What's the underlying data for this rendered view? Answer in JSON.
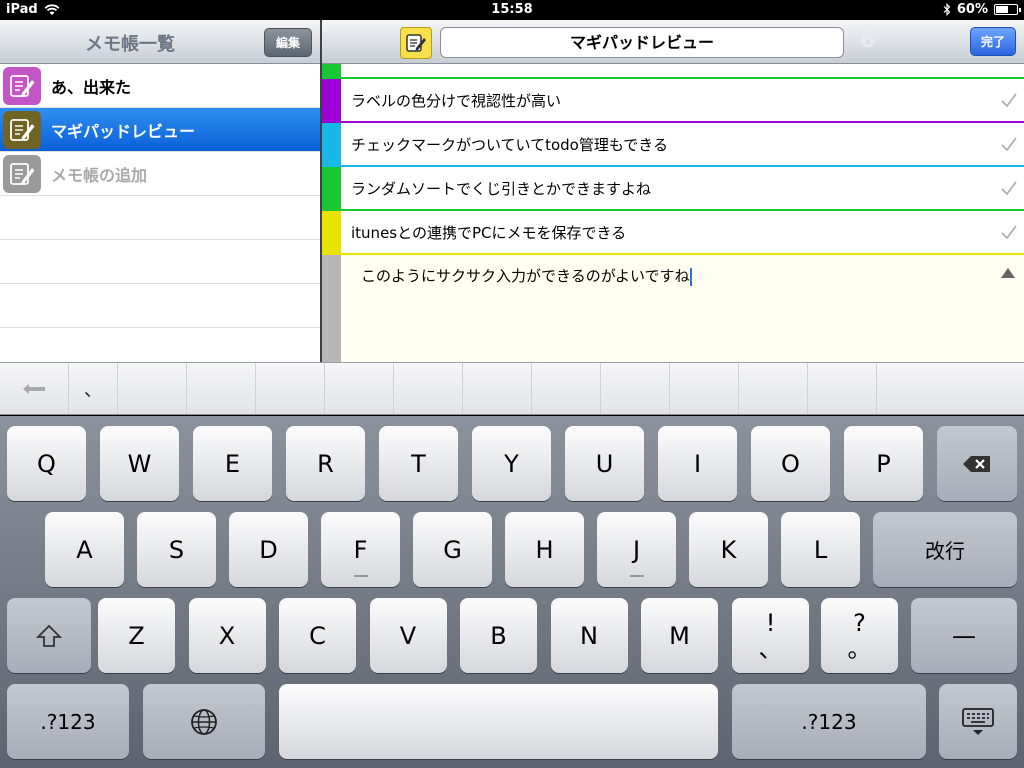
{
  "status_bar": {
    "device": "iPad",
    "time": "15:58",
    "battery": "60%",
    "battery_level": 0.6
  },
  "left_pane": {
    "title": "メモ帳一覧",
    "edit_button": "編集",
    "memos": [
      {
        "label": "あ、出来た",
        "icon_color": "#c455c6",
        "selected": false
      },
      {
        "label": "マギパッドレビュー",
        "icon_color": "#6f6424",
        "selected": true
      },
      {
        "label": "メモ帳の追加",
        "icon_color": "#9a9a9a",
        "selected": false
      }
    ]
  },
  "right_pane": {
    "title": "マギパッドレビュー",
    "count": "6",
    "done_button": "完了",
    "items": [
      {
        "text": "ラベルの色分けで視認性が高い",
        "color": "#9b00d6"
      },
      {
        "text": "チェックマークがついていてtodo管理もできる",
        "color": "#19b8e6"
      },
      {
        "text": "ランダムソートでくじ引きとかできますよね",
        "color": "#18c832"
      },
      {
        "text": "itunesとの連携でPCにメモを保存できる",
        "color": "#e8e400"
      }
    ],
    "editing_text": "このようにサクサク入力ができるのがよいですね"
  },
  "candidate_bar": {
    "back_icon": "arrow-left-icon",
    "first_candidate": "、"
  },
  "keyboard": {
    "row1": [
      "Q",
      "W",
      "E",
      "R",
      "T",
      "Y",
      "U",
      "I",
      "O",
      "P"
    ],
    "row2": [
      "A",
      "S",
      "D",
      "F",
      "G",
      "H",
      "J",
      "K",
      "L"
    ],
    "row3": [
      "Z",
      "X",
      "C",
      "V",
      "B",
      "N",
      "M"
    ],
    "return_label": "改行",
    "excl_top": "!",
    "excl_bottom": "、",
    "question_top": "?",
    "question_bottom": "。",
    "dash_label": "—",
    "num_left": ".?123",
    "num_right": ".?123"
  }
}
